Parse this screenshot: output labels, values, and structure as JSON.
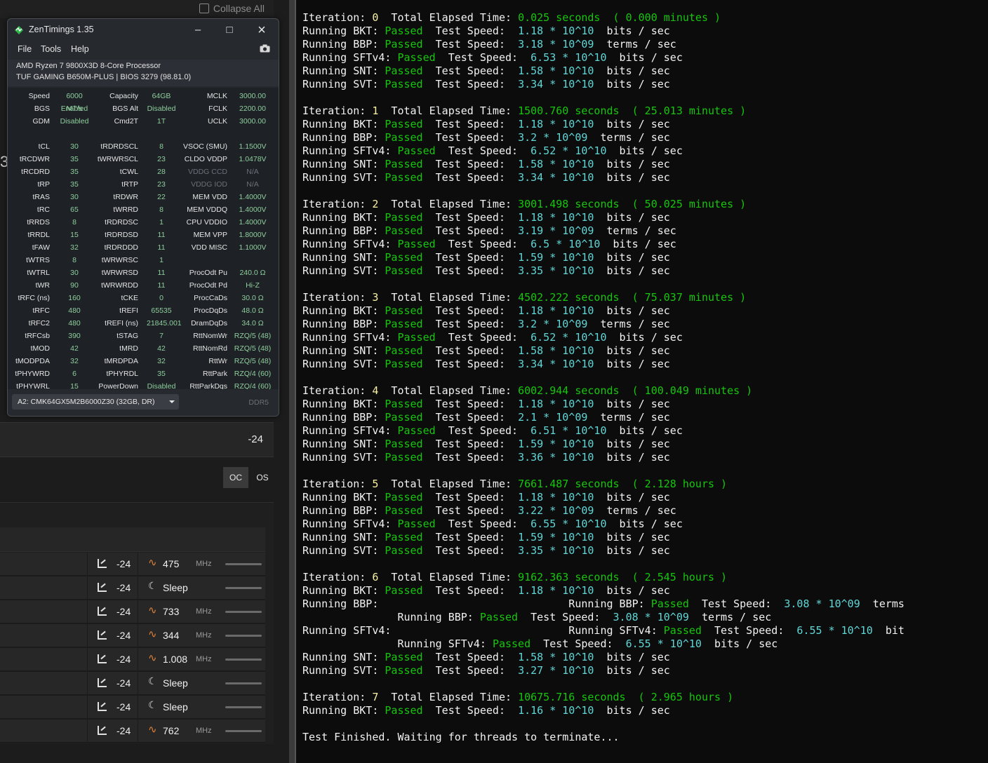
{
  "background_app": {
    "collapse_all": "Collapse All",
    "stub_text": "3(",
    "offset_value": "-24",
    "mode_oc": "OC",
    "mode_os": "OS",
    "mhz": "MHz",
    "cores": [
      {
        "offset": "-24",
        "freq": "475",
        "unit": "MHz",
        "state": "wave"
      },
      {
        "offset": "-24",
        "freq": "Sleep",
        "unit": "",
        "state": "sleep"
      },
      {
        "offset": "-24",
        "freq": "733",
        "unit": "MHz",
        "state": "wave"
      },
      {
        "offset": "-24",
        "freq": "344",
        "unit": "MHz",
        "state": "wave"
      },
      {
        "offset": "-24",
        "freq": "1.008",
        "unit": "MHz",
        "state": "wave"
      },
      {
        "offset": "-24",
        "freq": "Sleep",
        "unit": "",
        "state": "sleep"
      },
      {
        "offset": "-24",
        "freq": "Sleep",
        "unit": "",
        "state": "sleep"
      },
      {
        "offset": "-24",
        "freq": "762",
        "unit": "MHz",
        "state": "wave"
      }
    ]
  },
  "zentimings": {
    "title": "ZenTimings 1.35",
    "menu": [
      "File",
      "Tools",
      "Help"
    ],
    "cpu": "AMD Ryzen 7 9800X3D 8-Core Processor",
    "board": "TUF GAMING B650M-PLUS | BIOS 3279 (98.81.0)",
    "rows": [
      [
        "Speed",
        "6000 MT/s",
        "Capacity",
        "64GB",
        "MCLK",
        "3000.00"
      ],
      [
        "BGS",
        "Enabled",
        "BGS Alt",
        "Disabled",
        "FCLK",
        "2200.00"
      ],
      [
        "GDM",
        "Disabled",
        "Cmd2T",
        "1T",
        "UCLK",
        "3000.00"
      ],
      [
        "",
        "",
        "",
        "",
        "",
        ""
      ],
      [
        "tCL",
        "30",
        "tRDRDSCL",
        "8",
        "VSOC (SMU)",
        "1.1500V"
      ],
      [
        "tRCDWR",
        "35",
        "tWRWRSCL",
        "23",
        "CLDO VDDP",
        "1.0478V"
      ],
      [
        "tRCDRD",
        "35",
        "tCWL",
        "28",
        "VDDG CCD",
        "N/A"
      ],
      [
        "tRP",
        "35",
        "tRTP",
        "23",
        "VDDG IOD",
        "N/A"
      ],
      [
        "tRAS",
        "30",
        "tRDWR",
        "22",
        "MEM VDD",
        "1.4000V"
      ],
      [
        "tRC",
        "65",
        "tWRRD",
        "8",
        "MEM VDDQ",
        "1.4000V"
      ],
      [
        "tRRDS",
        "8",
        "tRDRDSC",
        "1",
        "CPU VDDIO",
        "1.4000V"
      ],
      [
        "tRRDL",
        "15",
        "tRDRDSD",
        "11",
        "MEM VPP",
        "1.8000V"
      ],
      [
        "tFAW",
        "32",
        "tRDRDDD",
        "11",
        "VDD MISC",
        "1.1000V"
      ],
      [
        "tWTRS",
        "8",
        "tWRWRSC",
        "1",
        "",
        ""
      ],
      [
        "tWTRL",
        "30",
        "tWRWRSD",
        "11",
        "ProcOdt Pu",
        "240.0 Ω"
      ],
      [
        "tWR",
        "90",
        "tWRWRDD",
        "11",
        "ProcOdt Pd",
        "Hi-Z"
      ],
      [
        "tRFC (ns)",
        "160",
        "tCKE",
        "0",
        "ProcCaDs",
        "30.0 Ω"
      ],
      [
        "tRFC",
        "480",
        "tREFI",
        "65535",
        "ProcDqDs",
        "48.0 Ω"
      ],
      [
        "tRFC2",
        "480",
        "tREFI (ns)",
        "21845.001",
        "DramDqDs",
        "34.0 Ω"
      ],
      [
        "tRFCsb",
        "390",
        "tSTAG",
        "7",
        "RttNomWr",
        "RZQ/5 (48)"
      ],
      [
        "tMOD",
        "42",
        "tMRD",
        "42",
        "RttNomRd",
        "RZQ/5 (48)"
      ],
      [
        "tMODPDA",
        "32",
        "tMRDPDA",
        "32",
        "RttWr",
        "RZQ/5 (48)"
      ],
      [
        "tPHYWRD",
        "6",
        "tPHYRDL",
        "35",
        "RttPark",
        "RZQ/4 (60)"
      ],
      [
        "tPHYWRL",
        "15",
        "PowerDown",
        "Disabled",
        "RttParkDqs",
        "RZQ/4 (60)"
      ]
    ],
    "dimm": "A2: CMK64GX5M2B6000Z30 (32GB, DR)",
    "ddr": "DDR5"
  },
  "terminal": {
    "lines": [
      [
        [
          "w",
          "Iteration: "
        ],
        [
          "y",
          "0"
        ],
        [
          "w",
          "  Total Elapsed Time: "
        ],
        [
          "g",
          "0.025 seconds  ( 0.000 minutes )"
        ]
      ],
      [
        [
          "w",
          "Running BKT: "
        ],
        [
          "g",
          "Passed"
        ],
        [
          "w",
          "  Test Speed:  "
        ],
        [
          "c",
          "1.18 * 10^10"
        ],
        [
          "w",
          "  bits / sec"
        ]
      ],
      [
        [
          "w",
          "Running BBP: "
        ],
        [
          "g",
          "Passed"
        ],
        [
          "w",
          "  Test Speed:  "
        ],
        [
          "c",
          "3.18 * 10^09"
        ],
        [
          "w",
          "  terms / sec"
        ]
      ],
      [
        [
          "w",
          "Running SFTv4: "
        ],
        [
          "g",
          "Passed"
        ],
        [
          "w",
          "  Test Speed:  "
        ],
        [
          "c",
          "6.53 * 10^10"
        ],
        [
          "w",
          "  bits / sec"
        ]
      ],
      [
        [
          "w",
          "Running SNT: "
        ],
        [
          "g",
          "Passed"
        ],
        [
          "w",
          "  Test Speed:  "
        ],
        [
          "c",
          "1.58 * 10^10"
        ],
        [
          "w",
          "  bits / sec"
        ]
      ],
      [
        [
          "w",
          "Running SVT: "
        ],
        [
          "g",
          "Passed"
        ],
        [
          "w",
          "  Test Speed:  "
        ],
        [
          "c",
          "3.34 * 10^10"
        ],
        [
          "w",
          "  bits / sec"
        ]
      ],
      [],
      [
        [
          "w",
          "Iteration: "
        ],
        [
          "y",
          "1"
        ],
        [
          "w",
          "  Total Elapsed Time: "
        ],
        [
          "g",
          "1500.760 seconds  ( 25.013 minutes )"
        ]
      ],
      [
        [
          "w",
          "Running BKT: "
        ],
        [
          "g",
          "Passed"
        ],
        [
          "w",
          "  Test Speed:  "
        ],
        [
          "c",
          "1.18 * 10^10"
        ],
        [
          "w",
          "  bits / sec"
        ]
      ],
      [
        [
          "w",
          "Running BBP: "
        ],
        [
          "g",
          "Passed"
        ],
        [
          "w",
          "  Test Speed:  "
        ],
        [
          "c",
          "3.2 * 10^09"
        ],
        [
          "w",
          "  terms / sec"
        ]
      ],
      [
        [
          "w",
          "Running SFTv4: "
        ],
        [
          "g",
          "Passed"
        ],
        [
          "w",
          "  Test Speed:  "
        ],
        [
          "c",
          "6.52 * 10^10"
        ],
        [
          "w",
          "  bits / sec"
        ]
      ],
      [
        [
          "w",
          "Running SNT: "
        ],
        [
          "g",
          "Passed"
        ],
        [
          "w",
          "  Test Speed:  "
        ],
        [
          "c",
          "1.58 * 10^10"
        ],
        [
          "w",
          "  bits / sec"
        ]
      ],
      [
        [
          "w",
          "Running SVT: "
        ],
        [
          "g",
          "Passed"
        ],
        [
          "w",
          "  Test Speed:  "
        ],
        [
          "c",
          "3.34 * 10^10"
        ],
        [
          "w",
          "  bits / sec"
        ]
      ],
      [],
      [
        [
          "w",
          "Iteration: "
        ],
        [
          "y",
          "2"
        ],
        [
          "w",
          "  Total Elapsed Time: "
        ],
        [
          "g",
          "3001.498 seconds  ( 50.025 minutes )"
        ]
      ],
      [
        [
          "w",
          "Running BKT: "
        ],
        [
          "g",
          "Passed"
        ],
        [
          "w",
          "  Test Speed:  "
        ],
        [
          "c",
          "1.18 * 10^10"
        ],
        [
          "w",
          "  bits / sec"
        ]
      ],
      [
        [
          "w",
          "Running BBP: "
        ],
        [
          "g",
          "Passed"
        ],
        [
          "w",
          "  Test Speed:  "
        ],
        [
          "c",
          "3.19 * 10^09"
        ],
        [
          "w",
          "  terms / sec"
        ]
      ],
      [
        [
          "w",
          "Running SFTv4: "
        ],
        [
          "g",
          "Passed"
        ],
        [
          "w",
          "  Test Speed:  "
        ],
        [
          "c",
          "6.5 * 10^10"
        ],
        [
          "w",
          "  bits / sec"
        ]
      ],
      [
        [
          "w",
          "Running SNT: "
        ],
        [
          "g",
          "Passed"
        ],
        [
          "w",
          "  Test Speed:  "
        ],
        [
          "c",
          "1.59 * 10^10"
        ],
        [
          "w",
          "  bits / sec"
        ]
      ],
      [
        [
          "w",
          "Running SVT: "
        ],
        [
          "g",
          "Passed"
        ],
        [
          "w",
          "  Test Speed:  "
        ],
        [
          "c",
          "3.35 * 10^10"
        ],
        [
          "w",
          "  bits / sec"
        ]
      ],
      [],
      [
        [
          "w",
          "Iteration: "
        ],
        [
          "y",
          "3"
        ],
        [
          "w",
          "  Total Elapsed Time: "
        ],
        [
          "g",
          "4502.222 seconds  ( 75.037 minutes )"
        ]
      ],
      [
        [
          "w",
          "Running BKT: "
        ],
        [
          "g",
          "Passed"
        ],
        [
          "w",
          "  Test Speed:  "
        ],
        [
          "c",
          "1.18 * 10^10"
        ],
        [
          "w",
          "  bits / sec"
        ]
      ],
      [
        [
          "w",
          "Running BBP: "
        ],
        [
          "g",
          "Passed"
        ],
        [
          "w",
          "  Test Speed:  "
        ],
        [
          "c",
          "3.2 * 10^09"
        ],
        [
          "w",
          "  terms / sec"
        ]
      ],
      [
        [
          "w",
          "Running SFTv4: "
        ],
        [
          "g",
          "Passed"
        ],
        [
          "w",
          "  Test Speed:  "
        ],
        [
          "c",
          "6.52 * 10^10"
        ],
        [
          "w",
          "  bits / sec"
        ]
      ],
      [
        [
          "w",
          "Running SNT: "
        ],
        [
          "g",
          "Passed"
        ],
        [
          "w",
          "  Test Speed:  "
        ],
        [
          "c",
          "1.58 * 10^10"
        ],
        [
          "w",
          "  bits / sec"
        ]
      ],
      [
        [
          "w",
          "Running SVT: "
        ],
        [
          "g",
          "Passed"
        ],
        [
          "w",
          "  Test Speed:  "
        ],
        [
          "c",
          "3.34 * 10^10"
        ],
        [
          "w",
          "  bits / sec"
        ]
      ],
      [],
      [
        [
          "w",
          "Iteration: "
        ],
        [
          "y",
          "4"
        ],
        [
          "w",
          "  Total Elapsed Time: "
        ],
        [
          "g",
          "6002.944 seconds  ( 100.049 minutes )"
        ]
      ],
      [
        [
          "w",
          "Running BKT: "
        ],
        [
          "g",
          "Passed"
        ],
        [
          "w",
          "  Test Speed:  "
        ],
        [
          "c",
          "1.18 * 10^10"
        ],
        [
          "w",
          "  bits / sec"
        ]
      ],
      [
        [
          "w",
          "Running BBP: "
        ],
        [
          "g",
          "Passed"
        ],
        [
          "w",
          "  Test Speed:  "
        ],
        [
          "c",
          "2.1 * 10^09"
        ],
        [
          "w",
          "  terms / sec"
        ]
      ],
      [
        [
          "w",
          "Running SFTv4: "
        ],
        [
          "g",
          "Passed"
        ],
        [
          "w",
          "  Test Speed:  "
        ],
        [
          "c",
          "6.51 * 10^10"
        ],
        [
          "w",
          "  bits / sec"
        ]
      ],
      [
        [
          "w",
          "Running SNT: "
        ],
        [
          "g",
          "Passed"
        ],
        [
          "w",
          "  Test Speed:  "
        ],
        [
          "c",
          "1.59 * 10^10"
        ],
        [
          "w",
          "  bits / sec"
        ]
      ],
      [
        [
          "w",
          "Running SVT: "
        ],
        [
          "g",
          "Passed"
        ],
        [
          "w",
          "  Test Speed:  "
        ],
        [
          "c",
          "3.36 * 10^10"
        ],
        [
          "w",
          "  bits / sec"
        ]
      ],
      [],
      [
        [
          "w",
          "Iteration: "
        ],
        [
          "y",
          "5"
        ],
        [
          "w",
          "  Total Elapsed Time: "
        ],
        [
          "g",
          "7661.487 seconds  ( 2.128 hours )"
        ]
      ],
      [
        [
          "w",
          "Running BKT: "
        ],
        [
          "g",
          "Passed"
        ],
        [
          "w",
          "  Test Speed:  "
        ],
        [
          "c",
          "1.18 * 10^10"
        ],
        [
          "w",
          "  bits / sec"
        ]
      ],
      [
        [
          "w",
          "Running BBP: "
        ],
        [
          "g",
          "Passed"
        ],
        [
          "w",
          "  Test Speed:  "
        ],
        [
          "c",
          "3.22 * 10^09"
        ],
        [
          "w",
          "  terms / sec"
        ]
      ],
      [
        [
          "w",
          "Running SFTv4: "
        ],
        [
          "g",
          "Passed"
        ],
        [
          "w",
          "  Test Speed:  "
        ],
        [
          "c",
          "6.55 * 10^10"
        ],
        [
          "w",
          "  bits / sec"
        ]
      ],
      [
        [
          "w",
          "Running SNT: "
        ],
        [
          "g",
          "Passed"
        ],
        [
          "w",
          "  Test Speed:  "
        ],
        [
          "c",
          "1.59 * 10^10"
        ],
        [
          "w",
          "  bits / sec"
        ]
      ],
      [
        [
          "w",
          "Running SVT: "
        ],
        [
          "g",
          "Passed"
        ],
        [
          "w",
          "  Test Speed:  "
        ],
        [
          "c",
          "3.35 * 10^10"
        ],
        [
          "w",
          "  bits / sec"
        ]
      ],
      [],
      [
        [
          "w",
          "Iteration: "
        ],
        [
          "y",
          "6"
        ],
        [
          "w",
          "  Total Elapsed Time: "
        ],
        [
          "g",
          "9162.363 seconds  ( 2.545 hours )"
        ]
      ],
      [
        [
          "w",
          "Running BKT: "
        ],
        [
          "g",
          "Passed"
        ],
        [
          "w",
          "  Test Speed:  "
        ],
        [
          "c",
          "1.18 * 10^10"
        ],
        [
          "w",
          "  bits / sec"
        ]
      ],
      [
        [
          "w",
          "Running BBP:                              Running BBP: "
        ],
        [
          "g",
          "Passed"
        ],
        [
          "w",
          "  Test Speed:  "
        ],
        [
          "c",
          "3.08 * 10^09"
        ],
        [
          "w",
          "  terms"
        ]
      ],
      [
        [
          "w",
          "               Running BBP: "
        ],
        [
          "g",
          "Passed"
        ],
        [
          "w",
          "  Test Speed:  "
        ],
        [
          "c",
          "3.08 * 10^09"
        ],
        [
          "w",
          "  terms / sec"
        ]
      ],
      [
        [
          "w",
          "Running SFTv4:                            Running SFTv4: "
        ],
        [
          "g",
          "Passed"
        ],
        [
          "w",
          "  Test Speed:  "
        ],
        [
          "c",
          "6.55 * 10^10"
        ],
        [
          "w",
          "  bit"
        ]
      ],
      [
        [
          "w",
          "               Running SFTv4: "
        ],
        [
          "g",
          "Passed"
        ],
        [
          "w",
          "  Test Speed:  "
        ],
        [
          "c",
          "6.55 * 10^10"
        ],
        [
          "w",
          "  bits / sec"
        ]
      ],
      [
        [
          "w",
          "Running SNT: "
        ],
        [
          "g",
          "Passed"
        ],
        [
          "w",
          "  Test Speed:  "
        ],
        [
          "c",
          "1.58 * 10^10"
        ],
        [
          "w",
          "  bits / sec"
        ]
      ],
      [
        [
          "w",
          "Running SVT: "
        ],
        [
          "g",
          "Passed"
        ],
        [
          "w",
          "  Test Speed:  "
        ],
        [
          "c",
          "3.27 * 10^10"
        ],
        [
          "w",
          "  bits / sec"
        ]
      ],
      [],
      [
        [
          "w",
          "Iteration: "
        ],
        [
          "y",
          "7"
        ],
        [
          "w",
          "  Total Elapsed Time: "
        ],
        [
          "g",
          "10675.716 seconds  ( 2.965 hours )"
        ]
      ],
      [
        [
          "w",
          "Running BKT: "
        ],
        [
          "g",
          "Passed"
        ],
        [
          "w",
          "  Test Speed:  "
        ],
        [
          "c",
          "1.16 * 10^10"
        ],
        [
          "w",
          "  bits / sec"
        ]
      ],
      [],
      [
        [
          "w",
          "Test Finished. Waiting for threads to terminate..."
        ]
      ]
    ]
  },
  "icons": {
    "app_logo": "zentimings-logo-icon",
    "camera": "camera-icon",
    "curve": "curve-optimizer-icon",
    "wave": "frequency-wave-icon",
    "sleep": "moon-sleep-icon",
    "collapse": "collapse-icon"
  },
  "colors": {
    "terminal_bg": "#0c0c0c",
    "green": "#16c60c",
    "cyan": "#61d6d6",
    "yellow": "#f9f1a5",
    "zt_value": "#8ecf9d",
    "accent_orange": "#e0803b"
  }
}
